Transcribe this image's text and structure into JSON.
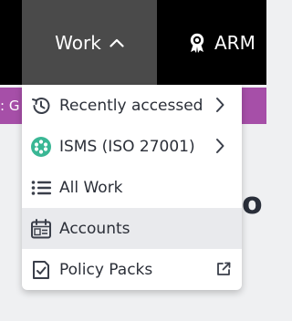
{
  "nav": {
    "work_label": "Work",
    "arm_label": "ARM"
  },
  "banner": {
    "text": ": G"
  },
  "background": {
    "heading_fragment": "o"
  },
  "menu": {
    "items": [
      {
        "label": "Recently accessed",
        "icon": "history-icon",
        "trailing": "chevron-right-icon"
      },
      {
        "label": "ISMS (ISO 27001)",
        "icon": "isms-icon",
        "trailing": "chevron-right-icon"
      },
      {
        "label": "All Work",
        "icon": "list-icon",
        "trailing": ""
      },
      {
        "label": "Accounts",
        "icon": "accounts-calendar-icon",
        "trailing": ""
      },
      {
        "label": "Policy Packs",
        "icon": "policy-checklist-icon",
        "trailing": "external-link-icon"
      }
    ]
  },
  "colors": {
    "topbar": "#000000",
    "active_nav": "#4a4a4a",
    "banner": "#a64fa8",
    "isms_icon": "#3ab795",
    "hover_row": "#e9eaed"
  }
}
